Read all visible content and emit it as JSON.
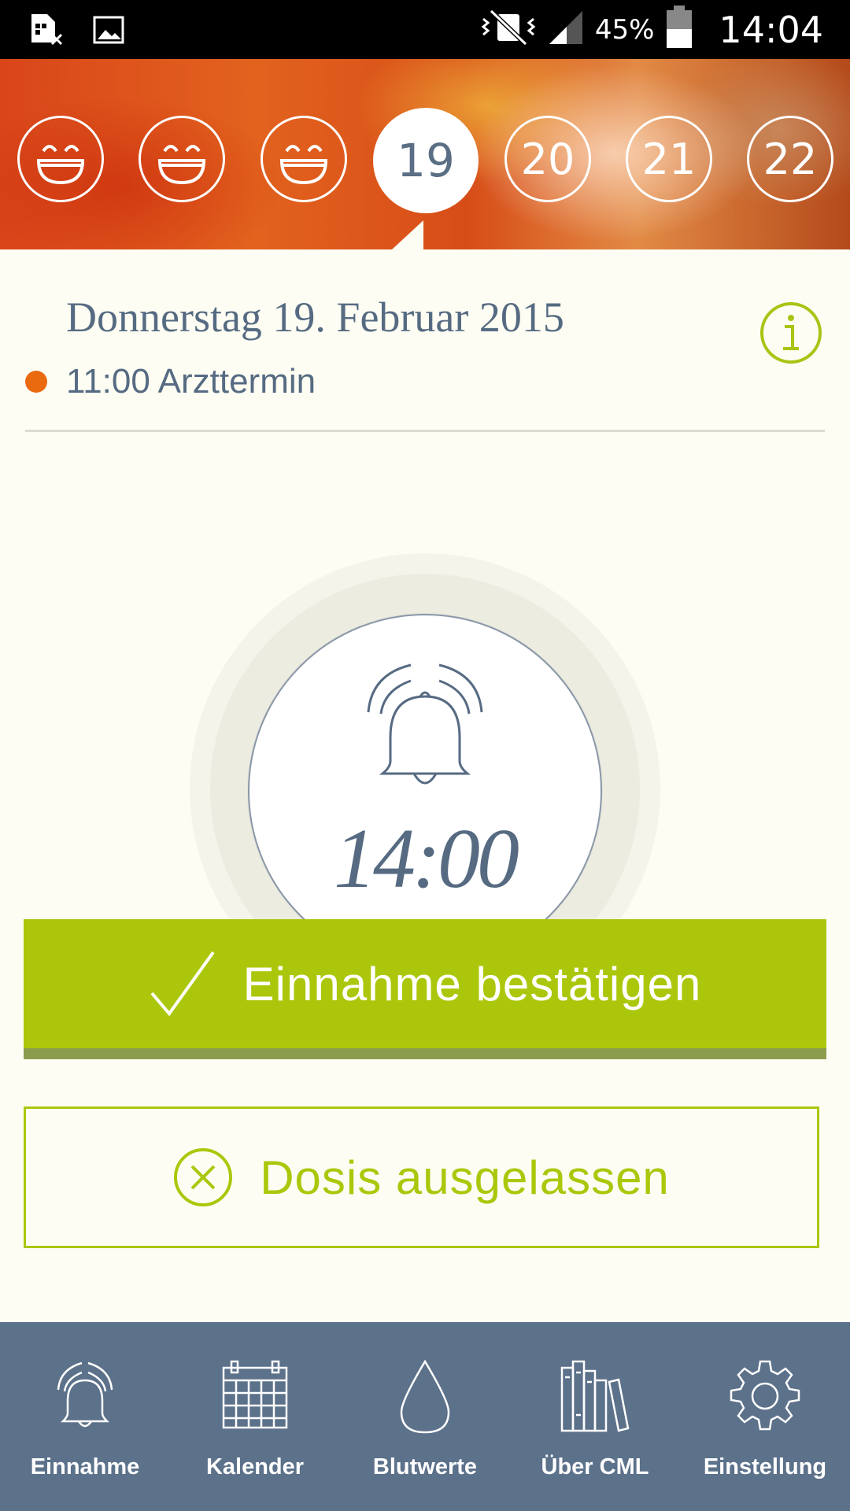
{
  "status_bar": {
    "battery_percent": "45%",
    "time": "14:04",
    "icons": [
      "sim-off-icon",
      "image-icon",
      "vibrate-icon",
      "signal-icon",
      "battery-icon"
    ]
  },
  "days": [
    {
      "type": "smiley",
      "icon": "smiley-icon"
    },
    {
      "type": "smiley",
      "icon": "smiley-icon"
    },
    {
      "type": "smiley",
      "icon": "smiley-icon"
    },
    {
      "type": "number",
      "label": "19",
      "selected": true
    },
    {
      "type": "number",
      "label": "20"
    },
    {
      "type": "number",
      "label": "21"
    },
    {
      "type": "number",
      "label": "22"
    }
  ],
  "date_title": "Donnerstag 19. Februar 2015",
  "appointment": {
    "text": "11:00 Arzttermin",
    "color": "#ea6a10"
  },
  "reminder": {
    "time": "14:00",
    "icon": "alarm-bell-icon"
  },
  "confirm_button": {
    "label": "Einnahme bestätigen",
    "icon": "checkmark-icon"
  },
  "skip_button": {
    "label": "Dosis ausgelassen",
    "icon": "cross-circle-icon"
  },
  "nav": [
    {
      "label": "Einnahme",
      "icon": "alarm-bell-icon"
    },
    {
      "label": "Kalender",
      "icon": "calendar-icon"
    },
    {
      "label": "Blutwerte",
      "icon": "drop-icon"
    },
    {
      "label": "Über CML",
      "icon": "books-icon"
    },
    {
      "label": "Einstellung",
      "icon": "gear-icon"
    }
  ],
  "colors": {
    "accent_green": "#acc70b",
    "slate": "#566b82",
    "nav_background": "#5c718a",
    "appointment_dot": "#ea6a10"
  }
}
